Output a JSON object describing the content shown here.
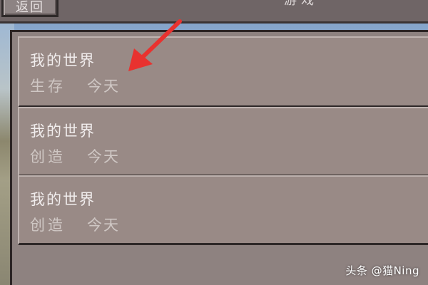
{
  "header": {
    "back_label": "返回",
    "title": "游戏"
  },
  "worlds": [
    {
      "name": "我的世界",
      "mode": "生存",
      "date": "今天"
    },
    {
      "name": "我的世界",
      "mode": "创造",
      "date": "今天"
    },
    {
      "name": "我的世界",
      "mode": "创造",
      "date": "今天"
    }
  ],
  "annotation": {
    "color": "#e8322f"
  },
  "watermark": "头条 @猫Ning"
}
